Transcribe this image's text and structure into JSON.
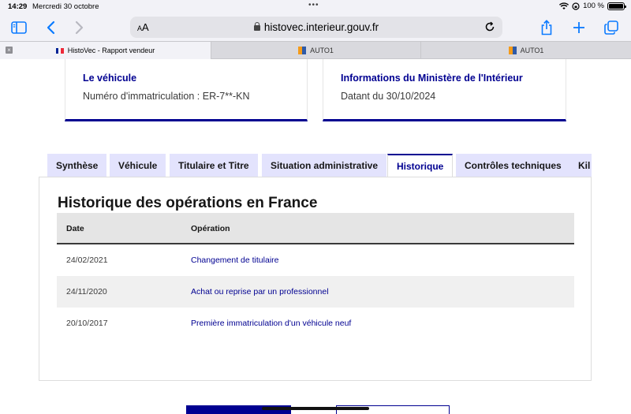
{
  "status_bar": {
    "time": "14:29",
    "date": "Mercredi 30 octobre",
    "battery": "100 %"
  },
  "browser": {
    "text_size_label_small": "A",
    "text_size_label_large": "A",
    "url": "histovec.interieur.gouv.fr",
    "accent_color": "#0a7aff",
    "icons": [
      "sidebar-icon",
      "back-icon",
      "forward-icon",
      "reload-icon",
      "share-icon",
      "new-tab-icon",
      "tab-overview-icon"
    ]
  },
  "browser_tabs": [
    {
      "label": "HistoVec - Rapport vendeur",
      "active": true
    },
    {
      "label": "AUTO1",
      "active": false
    },
    {
      "label": "AUTO1",
      "active": false
    }
  ],
  "cards": [
    {
      "title": "Le véhicule",
      "text": "Numéro d'immatriculation : ER-7**-KN"
    },
    {
      "title": "Informations du Ministère de l'Intérieur",
      "text": "Datant du 30/10/2024"
    }
  ],
  "page_tabs": [
    {
      "label": "Synthèse",
      "active": false
    },
    {
      "label": "Véhicule",
      "active": false
    },
    {
      "label": "Titulaire et Titre",
      "active": false
    },
    {
      "label": "Situation administrative",
      "active": false
    },
    {
      "label": "Historique",
      "active": true
    },
    {
      "label": "Contrôles techniques",
      "active": false
    },
    {
      "label": "Kil",
      "active": false
    }
  ],
  "history": {
    "title": "Historique des opérations en France",
    "columns": {
      "date": "Date",
      "operation": "Opération"
    },
    "rows": [
      {
        "date": "24/02/2021",
        "operation": "Changement de titulaire"
      },
      {
        "date": "24/11/2020",
        "operation": "Achat ou reprise par un professionnel"
      },
      {
        "date": "20/10/2017",
        "operation": "Première immatriculation d'un véhicule neuf"
      }
    ]
  },
  "colors": {
    "brand_blue": "#000091",
    "tab_background": "#e3e3fd",
    "table_header": "#e5e5e5"
  }
}
